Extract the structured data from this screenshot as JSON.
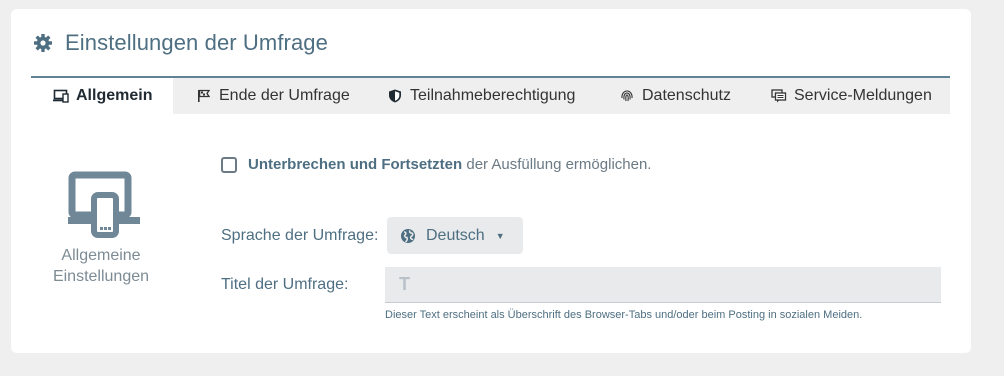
{
  "header": {
    "title": "Einstellungen der Umfrage",
    "icon": "gear-icon"
  },
  "tabs": [
    {
      "label": "Allgemein",
      "icon": "devices-icon",
      "active": true
    },
    {
      "label": "Ende der Umfrage",
      "icon": "flag-icon",
      "active": false
    },
    {
      "label": "Teilnahmeberechtigung",
      "icon": "shield-icon",
      "active": false
    },
    {
      "label": "Datenschutz",
      "icon": "fingerprint-icon",
      "active": false
    },
    {
      "label": "Service-Meldungen",
      "icon": "chat-icon",
      "active": false
    }
  ],
  "side": {
    "label_line1": "Allgemeine",
    "label_line2": "Einstellungen",
    "icon": "devices-icon"
  },
  "pause_option": {
    "bold": "Unterbrechen und Fortsetzten",
    "rest": " der Ausfüllung ermöglichen.",
    "checked": false
  },
  "language": {
    "label": "Sprache der Umfrage:",
    "value": "Deutsch",
    "icon": "globe-icon"
  },
  "survey_title": {
    "label": "Titel der Umfrage:",
    "value": "",
    "hint": "Dieser Text erscheint als Überschrift des Browser-Tabs und/oder beim Posting in sozialen Meiden."
  },
  "colors": {
    "accent": "#4e6f82",
    "tab_border": "#5f8394",
    "background": "#efefef"
  }
}
